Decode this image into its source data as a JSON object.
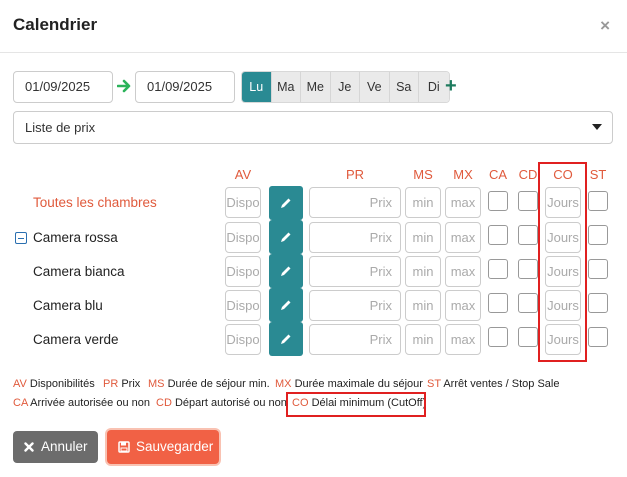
{
  "modal": {
    "title": "Calendrier",
    "close": "×"
  },
  "dates": {
    "from": "01/09/2025",
    "to": "01/09/2025"
  },
  "days": [
    "Lu",
    "Ma",
    "Me",
    "Je",
    "Ve",
    "Sa",
    "Di"
  ],
  "active_day": "Lu",
  "plus": "+",
  "select": {
    "value": "Liste de prix"
  },
  "columns": {
    "av": "AV",
    "pr": "PR",
    "ms": "MS",
    "mx": "MX",
    "ca": "CA",
    "cd": "CD",
    "co": "CO",
    "st": "ST"
  },
  "rows": [
    {
      "label": "Toutes les chambres"
    },
    {
      "label": "Camera rossa"
    },
    {
      "label": "Camera bianca"
    },
    {
      "label": "Camera blu"
    },
    {
      "label": "Camera verde"
    }
  ],
  "placeholders": {
    "av": "Dispo",
    "pr": "Prix",
    "ms": "min",
    "mx": "max",
    "co": "Jours"
  },
  "legend": {
    "av": {
      "abbr": "AV",
      "text": "Disponibilités"
    },
    "pr": {
      "abbr": "PR",
      "text": "Prix"
    },
    "ms": {
      "abbr": "MS",
      "text": "Durée de séjour min."
    },
    "mx": {
      "abbr": "MX",
      "text": "Durée maximale du séjour"
    },
    "st": {
      "abbr": "ST",
      "text": "Arrêt ventes / Stop Sale"
    },
    "ca": {
      "abbr": "CA",
      "text": "Arrivée autorisée ou non"
    },
    "cd": {
      "abbr": "CD",
      "text": "Départ autorisé ou non"
    },
    "co": {
      "abbr": "CO",
      "text": "Délai minimum (CutOff)"
    }
  },
  "buttons": {
    "cancel": "Annuler",
    "save": "Sauvegarder"
  },
  "colors": {
    "accent": "#2a8a93",
    "label": "#e05a3c",
    "save": "#f16145",
    "highlight": "#e02020"
  }
}
